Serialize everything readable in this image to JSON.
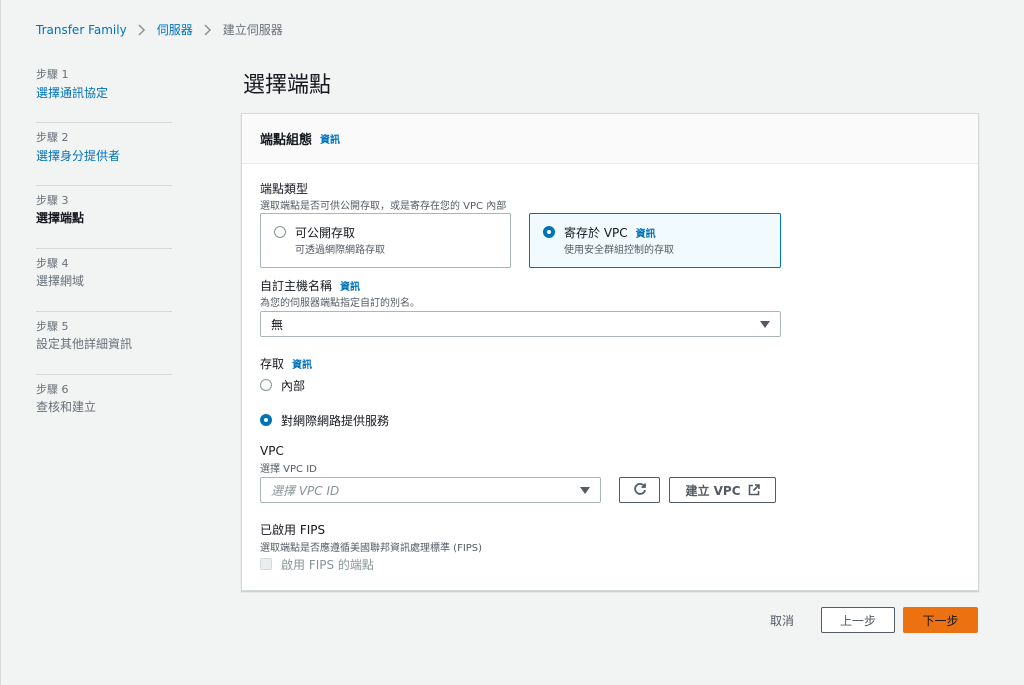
{
  "breadcrumb": {
    "root": "Transfer Family",
    "servers": "伺服器",
    "current": "建立伺服器"
  },
  "steps": [
    {
      "num": "步驟 1",
      "label": "選擇通訊協定"
    },
    {
      "num": "步驟 2",
      "label": "選擇身分提供者"
    },
    {
      "num": "步驟 3",
      "label": "選擇端點"
    },
    {
      "num": "步驟 4",
      "label": "選擇網域"
    },
    {
      "num": "步驟 5",
      "label": "設定其他詳細資訊"
    },
    {
      "num": "步驟 6",
      "label": "查核和建立"
    }
  ],
  "page_title": "選擇端點",
  "panel": {
    "title": "端點組態",
    "info": "資訊",
    "endpoint_type": {
      "label": "端點類型",
      "desc": "選取端點是否可供公開存取，或是寄存在您的 VPC 內部",
      "public": {
        "title": "可公開存取",
        "desc": "可透過網際網路存取"
      },
      "vpc": {
        "title": "寄存於 VPC",
        "info": "資訊",
        "desc": "使用安全群組控制的存取"
      }
    },
    "hostname": {
      "label": "自訂主機名稱",
      "info": "資訊",
      "desc": "為您的伺服器端點指定自訂的別名。",
      "value": "無"
    },
    "access": {
      "label": "存取",
      "info": "資訊",
      "internal": "內部",
      "internet": "對網際網路提供服務"
    },
    "vpc": {
      "label": "VPC",
      "desc": "選擇 VPC ID",
      "placeholder": "選擇 VPC ID",
      "create": "建立 VPC"
    },
    "fips": {
      "label": "已啟用 FIPS",
      "desc": "選取端點是否應遵循美國聯邦資訊處理標準 (FIPS)",
      "checkbox": "啟用 FIPS 的端點"
    }
  },
  "footer": {
    "cancel": "取消",
    "prev": "上一步",
    "next": "下一步"
  },
  "colors": {
    "link": "#0073bb",
    "primary": "#ec7211",
    "selected_bg": "#f1faff"
  }
}
